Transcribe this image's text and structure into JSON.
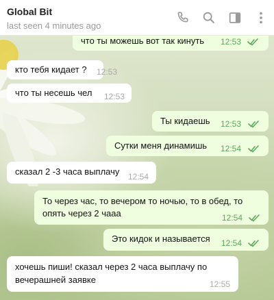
{
  "header": {
    "name": "Global Bit",
    "status": "last seen 4 minutes ago",
    "icons": [
      "phone-icon",
      "search-icon",
      "sidebar-icon",
      "more-icon"
    ]
  },
  "messages": [
    {
      "dir": "out",
      "text": "что ты можешь вот так кинуть",
      "time": "12:53",
      "read": true
    },
    {
      "dir": "in",
      "text": "кто тебя кидает ?",
      "time": "12:53"
    },
    {
      "dir": "in",
      "text": "что ты несешь чел",
      "time": "12:53"
    },
    {
      "dir": "out",
      "text": "Ты кидаешь",
      "time": "12:53",
      "read": true
    },
    {
      "dir": "out",
      "text": "Сутки меня динамишь",
      "time": "12:54",
      "read": true
    },
    {
      "dir": "in",
      "text": "сказал 2 -3 часа выплачу",
      "time": "12:54"
    },
    {
      "dir": "out",
      "lines": [
        "То через час, то вечером  то ночью, то в обед, то",
        "опять через 2 чааа"
      ],
      "time": "12:54",
      "read": true
    },
    {
      "dir": "out",
      "text": "Это кидок и называется",
      "time": "12:54",
      "read": true
    },
    {
      "dir": "in",
      "lines": [
        "хочешь пиши! сказал через 2 часа выплачу по",
        "вечерашней заявке"
      ],
      "time": "12:55"
    }
  ],
  "colors": {
    "incoming_bubble": "#ffffff",
    "outgoing_bubble": "#eefedf",
    "read_check": "#5aa95a"
  }
}
